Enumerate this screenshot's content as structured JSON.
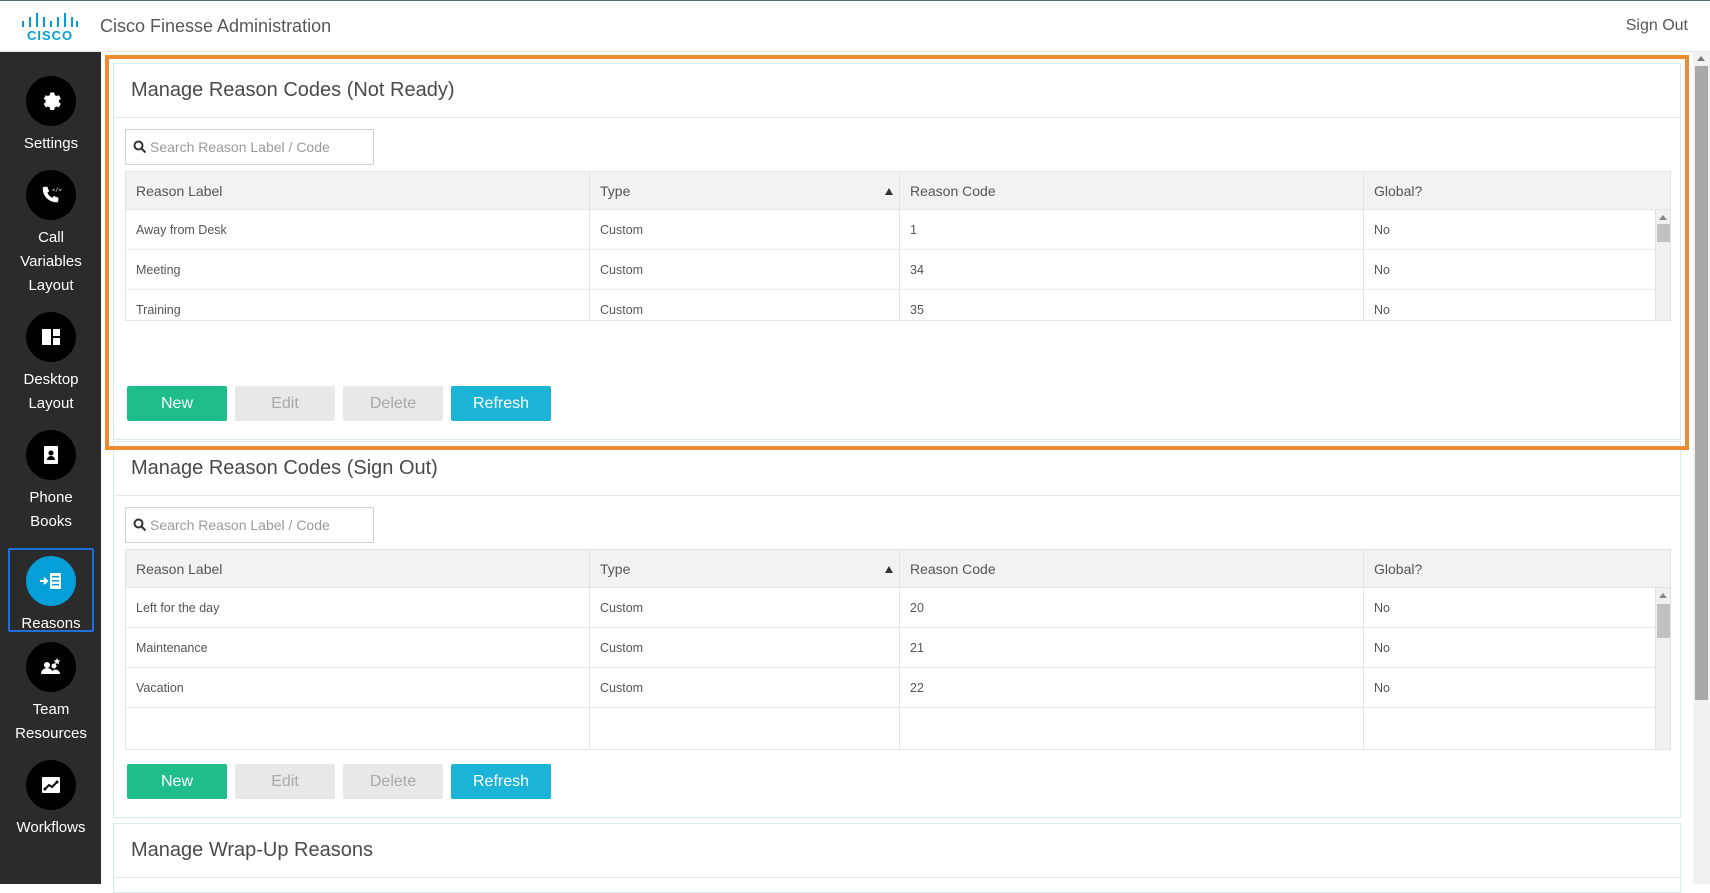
{
  "header": {
    "logo_text": "CISCO",
    "title": "Cisco Finesse Administration",
    "sign_out": "Sign Out",
    "logo_color": "#049fd9"
  },
  "sidebar": {
    "items": [
      {
        "label": "Settings",
        "icon": "gear-icon"
      },
      {
        "label": "Call Variables Layout",
        "icon": "call-variables-icon"
      },
      {
        "label": "Desktop Layout",
        "icon": "desktop-layout-icon"
      },
      {
        "label": "Phone Books",
        "icon": "phone-book-icon"
      },
      {
        "label": "Reasons",
        "icon": "reasons-icon",
        "active": true
      },
      {
        "label": "Team Resources",
        "icon": "team-resources-icon"
      },
      {
        "label": "Workflows",
        "icon": "workflows-icon"
      }
    ]
  },
  "panels": {
    "not_ready": {
      "title": "Manage Reason Codes (Not Ready)",
      "search_placeholder": "Search Reason Label / Code",
      "columns": [
        "Reason Label",
        "Type",
        "Reason Code",
        "Global?"
      ],
      "rows": [
        [
          "Away from Desk",
          "Custom",
          "1",
          "No"
        ],
        [
          "Meeting",
          "Custom",
          "34",
          "No"
        ],
        [
          "Training",
          "Custom",
          "35",
          "No"
        ]
      ],
      "buttons": {
        "new": "New",
        "edit": "Edit",
        "delete": "Delete",
        "refresh": "Refresh"
      }
    },
    "sign_out": {
      "title": "Manage Reason Codes (Sign Out)",
      "search_placeholder": "Search Reason Label / Code",
      "columns": [
        "Reason Label",
        "Type",
        "Reason Code",
        "Global?"
      ],
      "rows": [
        [
          "Left for the day",
          "Custom",
          "20",
          "No"
        ],
        [
          "Maintenance",
          "Custom",
          "21",
          "No"
        ],
        [
          "Vacation",
          "Custom",
          "22",
          "No"
        ]
      ],
      "buttons": {
        "new": "New",
        "edit": "Edit",
        "delete": "Delete",
        "refresh": "Refresh"
      }
    },
    "wrap_up": {
      "title": "Manage Wrap-Up Reasons"
    }
  },
  "colors": {
    "new_button": "#1fbd8b",
    "refresh_button": "#1bb3d6",
    "highlight": "#f08a30",
    "sidebar_bg": "#2b2b2b",
    "active_nav": "#049fd9"
  }
}
